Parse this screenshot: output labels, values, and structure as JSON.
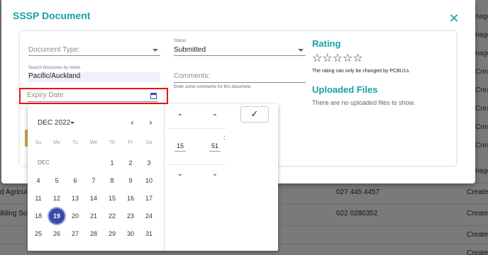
{
  "background": {
    "right_links": [
      "nage",
      "nage",
      "nage",
      "Create",
      "Create",
      "Create",
      "Create",
      "Create",
      "nage"
    ],
    "rows": [
      {
        "col1": "d Agricul",
        "phone": "027 445 4457",
        "action": "Create s"
      },
      {
        "col1": "ilding Sol",
        "phone": "022 0280352",
        "action": "Create s"
      },
      {
        "col1": "",
        "phone": "",
        "action": "Create s"
      },
      {
        "col1": "",
        "phone": "",
        "action": "Create s"
      }
    ]
  },
  "modal": {
    "title": "SSSP Document",
    "close_icon": "close-icon",
    "document_type": {
      "label": "Document Type:",
      "value": ""
    },
    "status": {
      "small_label": "Status:",
      "value": "Submitted"
    },
    "timezone": {
      "small_label": "Search timezones by name.",
      "value": "Pacific/Auckland"
    },
    "comments": {
      "label": "Comments:",
      "hint": "Enter some comments for this document."
    },
    "expiry_date": {
      "placeholder": "Expiry Date",
      "icon": "calendar-icon"
    },
    "rating": {
      "title": "Rating",
      "stars": "☆☆☆☆☆",
      "note": "The rating can only be changed by PCBU1s."
    },
    "uploaded_files": {
      "title": "Uploaded Files",
      "note": "There are no uploaded files to show."
    }
  },
  "picker": {
    "month_year": "DEC 2022",
    "prev_icon": "‹",
    "next_icon": "›",
    "weekdays": [
      "Su",
      "Mo",
      "Tu",
      "We",
      "Th",
      "Fr",
      "Sa"
    ],
    "month_abbr": "DEC",
    "weeks": [
      [
        "",
        "",
        "",
        "",
        "1",
        "2",
        "3"
      ],
      [
        "4",
        "5",
        "6",
        "7",
        "8",
        "9",
        "10"
      ],
      [
        "11",
        "12",
        "13",
        "14",
        "15",
        "16",
        "17"
      ],
      [
        "18",
        "19",
        "20",
        "21",
        "22",
        "23",
        "24"
      ],
      [
        "25",
        "26",
        "27",
        "28",
        "29",
        "30",
        "31"
      ]
    ],
    "selected_day": "19",
    "time": {
      "hour": "15",
      "minute": "51",
      "separator": ":"
    },
    "up_arrow": "⌃",
    "down_arrow": "⌄",
    "confirm_icon": "✓",
    "accent": "#3949ab"
  },
  "colors": {
    "accent": "#17a2a4",
    "highlight": "#e11111",
    "button": "#c8ad3a"
  }
}
